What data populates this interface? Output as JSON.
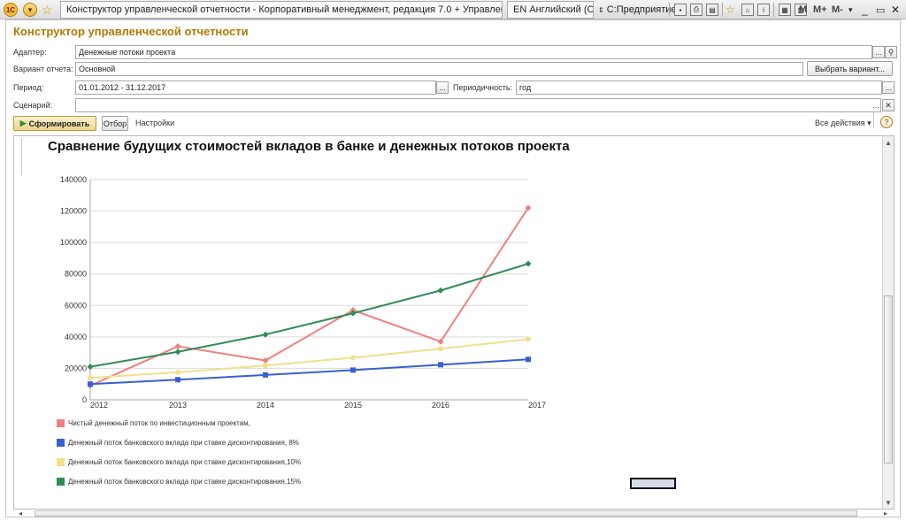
{
  "titlebar": {
    "logo": "1С",
    "window_title": "Конструктор управленческой отчетности - Корпоративный менеджмент, редакция 7.0 + Управление производственным п",
    "language": "EN Английский (США)",
    "enterprise": "С:Предприятие",
    "memory_buttons": [
      "M",
      "M+",
      "M-"
    ]
  },
  "form": {
    "title": "Конструктор управленческой отчетности",
    "adapter_label": "Адаптер:",
    "adapter_value": "Денежные потоки проекта",
    "variant_label": "Вариант отчета:",
    "variant_value": "Основной",
    "choose_variant_button": "Выбрать вариант...",
    "period_label": "Период:",
    "period_value": "01.01.2012 - 31.12.2017",
    "periodicity_label": "Периодичность:",
    "periodicity_value": "год",
    "scenario_label": "Сценарий:",
    "scenario_value": "",
    "ellipsis": "...",
    "clear": "✕"
  },
  "toolbar": {
    "generate_button": "Сформировать",
    "filter_button": "Отбор",
    "settings_button": "Настройки",
    "all_actions": "Все действия",
    "help": "?"
  },
  "report": {
    "title": "Сравнение будущих стоимостей вкладов в банке и денежных потоков проекта"
  },
  "chart_data": {
    "type": "line",
    "title": "Сравнение будущих стоимостей вкладов в банке и денежных потоков проекта",
    "xlabel": "",
    "ylabel": "",
    "x": [
      "2012",
      "2013",
      "2014",
      "2015",
      "2016",
      "2017"
    ],
    "ylim": [
      0,
      140000
    ],
    "yticks": [
      "0",
      "20000",
      "40000",
      "60000",
      "80000",
      "100000",
      "120000",
      "140000"
    ],
    "grid": true,
    "legend_position": "bottom",
    "series": [
      {
        "name": "Чистый денежный поток по инвестиционным проектам,",
        "color": "#f08080",
        "marker": "diamond",
        "values": [
          9000,
          34000,
          25000,
          57000,
          37000,
          122000
        ]
      },
      {
        "name": "Денежный поток банковского вклада при ставке дисконтирования, 8%",
        "color": "#3a5fd0",
        "marker": "square",
        "values": [
          10000,
          12800,
          15800,
          18900,
          22300,
          25700
        ]
      },
      {
        "name": "Денежный поток банковского вклада при ставке дисконтирования,10%",
        "color": "#f0e08a",
        "marker": "circle",
        "values": [
          14000,
          17500,
          21800,
          26800,
          32500,
          38500
        ]
      },
      {
        "name": "Денежный поток банковского вклада при ставке дисконтирования,15%",
        "color": "#2e8b57",
        "marker": "diamond",
        "values": [
          21000,
          30500,
          41500,
          55000,
          69500,
          86500
        ]
      }
    ]
  }
}
